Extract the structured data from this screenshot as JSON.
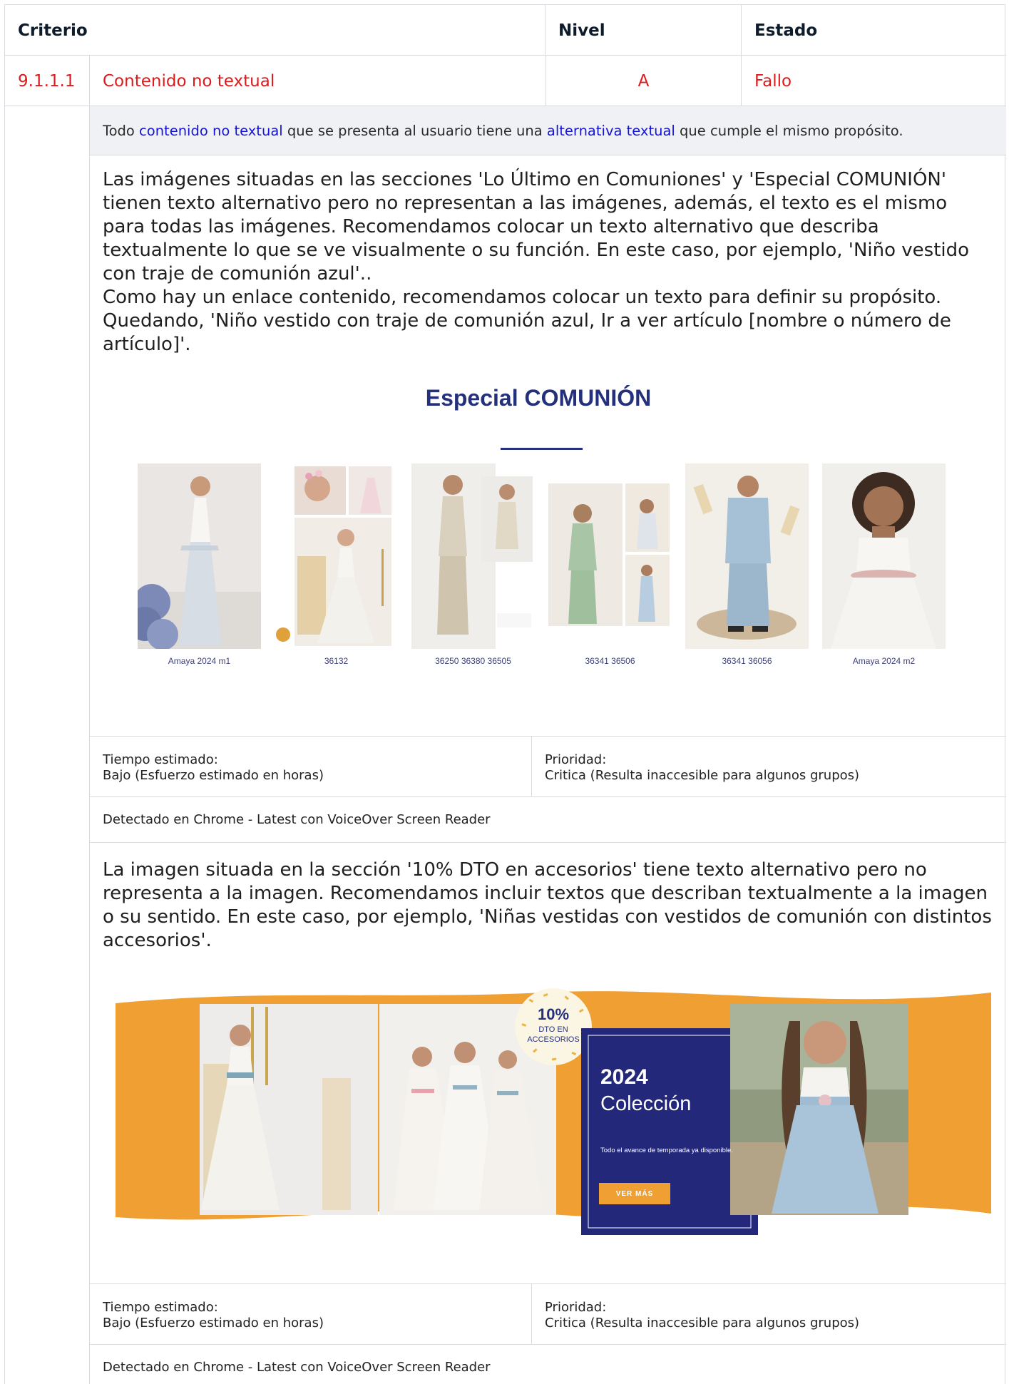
{
  "table": {
    "header": {
      "criterio": "Criterio",
      "nivel": "Nivel",
      "estado": "Estado"
    },
    "row": {
      "id": "9.1.1.1",
      "title": "Contenido no textual",
      "nivel": "A",
      "estado": "Fallo"
    },
    "description": {
      "part1": "Todo ",
      "link1": "contenido no textual",
      "part2": " que se presenta al usuario tiene una ",
      "link2": "alternativa textual",
      "part3": " que cumple el mismo propósito."
    }
  },
  "findings": [
    {
      "text": "Las imágenes situadas en las secciones 'Lo Último en Comuniones' y 'Especial COMUNIÓN' tienen texto alternativo pero no representan a las imágenes, además, el texto es el mismo para todas las imágenes. Recomendamos colocar un texto alternativo que describa textualmente lo que se ve visualmente o su función. En este caso, por ejemplo, 'Niño vestido con traje de comunión azul'..\nComo hay un enlace contenido, recomendamos colocar un texto para definir su propósito. Quedando, 'Niño vestido con traje de comunión azul, Ir a ver artículo [nombre o número de artículo]'.",
      "tiempo_label": "Tiempo estimado:",
      "tiempo_value": "Bajo (Esfuerzo estimado en horas)",
      "prioridad_label": "Prioridad:",
      "prioridad_value": "Critica (Resulta inaccesible para algunos grupos)",
      "detected": "Detectado en Chrome - Latest con VoiceOver Screen Reader"
    },
    {
      "text": "La imagen situada en la sección '10% DTO en accesorios' tiene texto alternativo pero no representa a la imagen. Recomendamos incluir textos que describan textualmente a la imagen o su sentido. En este caso, por ejemplo, 'Niñas vestidas con vestidos de comunión con distintos accesorios'.",
      "tiempo_label": "Tiempo estimado:",
      "tiempo_value": "Bajo (Esfuerzo estimado en horas)",
      "prioridad_label": "Prioridad:",
      "prioridad_value": "Critica (Resulta inaccesible para algunos grupos)",
      "detected": "Detectado en Chrome - Latest con VoiceOver Screen Reader"
    }
  ],
  "gallery": {
    "title": "Especial COMUNIÓN",
    "captions": [
      "Amaya 2024 m1",
      "36132",
      "36250 36380 36505",
      "36341 36506",
      "36341 36056",
      "Amaya 2024 m2"
    ]
  },
  "banner": {
    "badge_pct": "10%",
    "badge_line1": "DTO EN",
    "badge_line2": "ACCESORIOS",
    "year": "2024",
    "collection": "Colección",
    "tagline": "Todo el avance de temporada ya disponible.",
    "cta": "VER MÁS"
  },
  "colors": {
    "fail_red": "#e0191b",
    "link_blue": "#1515d8",
    "brand_navy": "#25307c",
    "banner_orange": "#f0a032",
    "banner_blue": "#23287a"
  }
}
